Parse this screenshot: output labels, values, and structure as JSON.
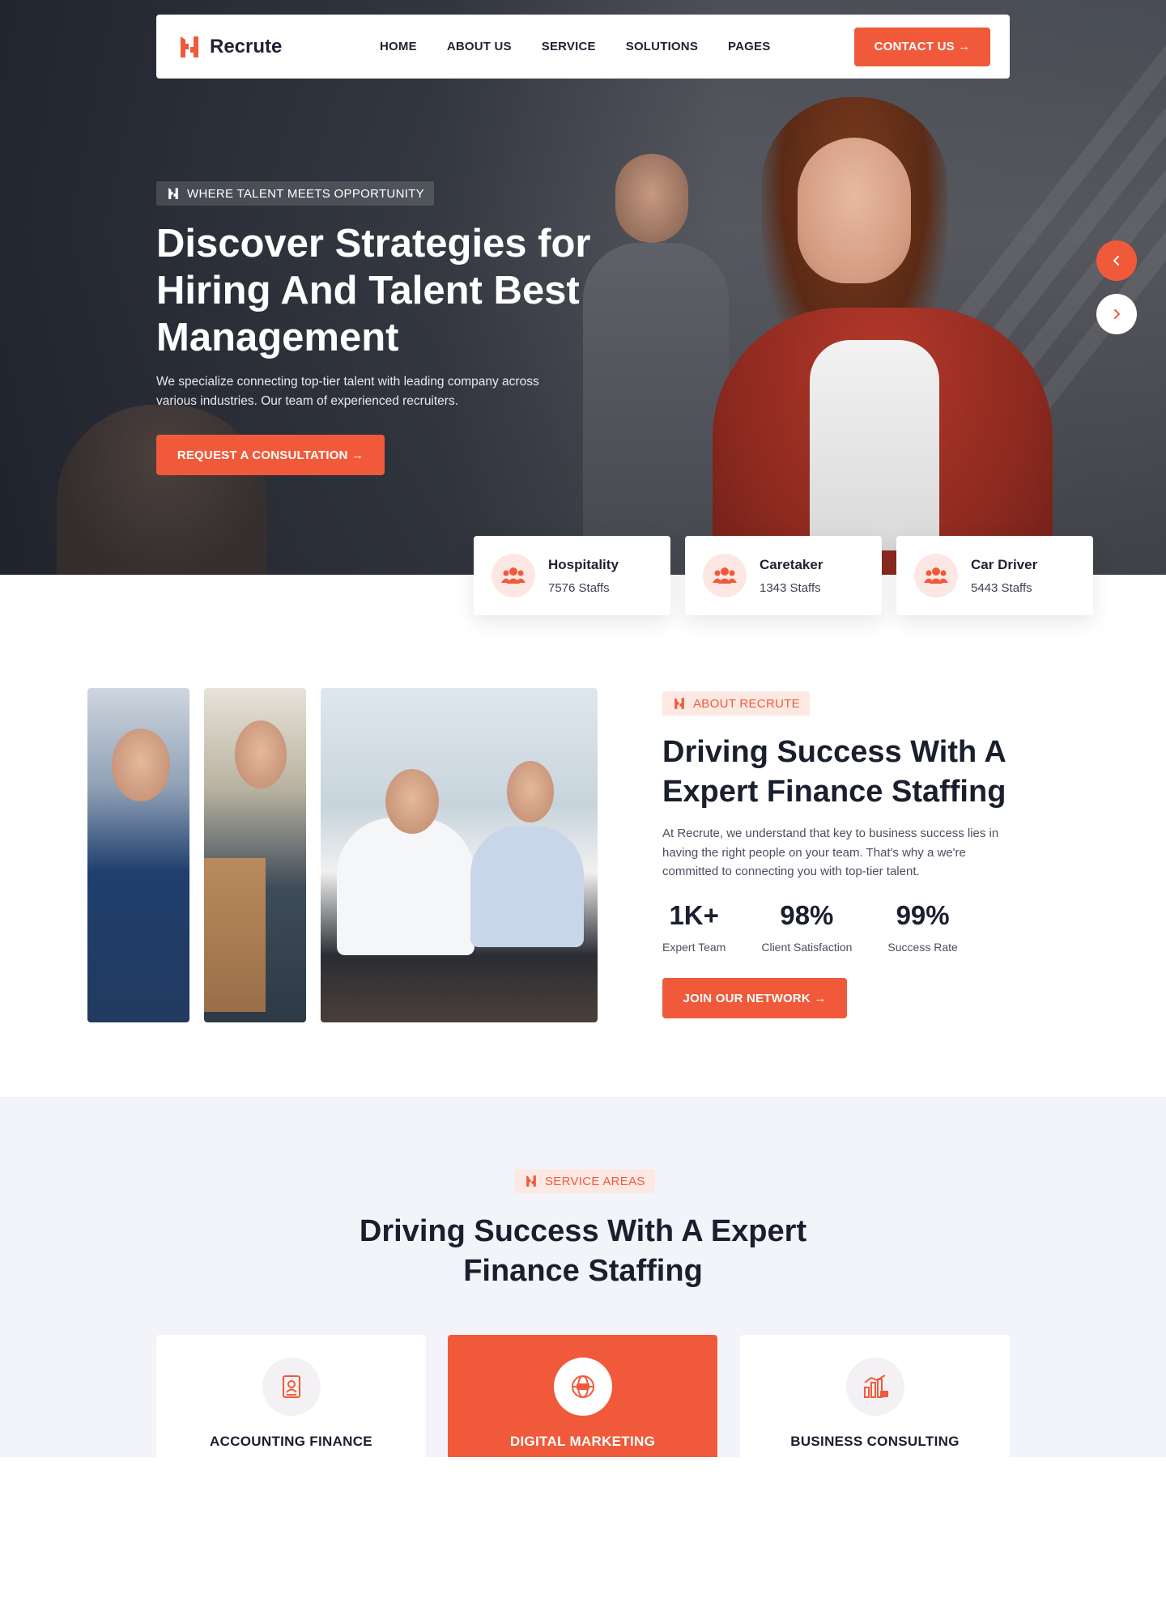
{
  "brand": {
    "name": "Recrute",
    "accent": "#f05a3a"
  },
  "nav": {
    "items": [
      "HOME",
      "ABOUT US",
      "SERVICE",
      "SOLUTIONS",
      "PAGES"
    ],
    "cta": "CONTACT US →"
  },
  "hero": {
    "eyebrow": "WHERE TALENT MEETS OPPORTUNITY",
    "title": "Discover Strategies for Hiring And Talent Best Management",
    "description": "We specialize connecting top-tier talent with leading company across various industries. Our team of experienced recruiters.",
    "cta": "REQUEST A CONSULTATION →",
    "prev_icon": "chevron-left-icon",
    "next_icon": "chevron-right-icon"
  },
  "categories": [
    {
      "name": "Hospitality",
      "count": "7576 Staffs",
      "icon": "users-icon"
    },
    {
      "name": "Caretaker",
      "count": "1343 Staffs",
      "icon": "users-icon"
    },
    {
      "name": "Car Driver",
      "count": "5443 Staffs",
      "icon": "users-icon"
    }
  ],
  "about": {
    "tag": "ABOUT RECRUTE",
    "title": "Driving Success With A Expert Finance Staffing",
    "description": "At Recrute, we understand that key to business success lies in having the right people on your team. That's why a we're committed to connecting you with top-tier talent.",
    "stats": [
      {
        "value": "1K+",
        "label": "Expert Team"
      },
      {
        "value": "98%",
        "label": "Client Satisfaction"
      },
      {
        "value": "99%",
        "label": "Success Rate"
      }
    ],
    "cta": "JOIN OUR NETWORK →"
  },
  "services": {
    "tag": "SERVICE AREAS",
    "title": "Driving Success With A Expert Finance Staffing",
    "items": [
      {
        "label": "ACCOUNTING FINANCE",
        "icon": "finance-document-icon",
        "active": false
      },
      {
        "label": "DIGITAL MARKETING",
        "icon": "seo-globe-icon",
        "active": true
      },
      {
        "label": "BUSINESS CONSULTING",
        "icon": "bar-chart-icon",
        "active": false
      }
    ]
  }
}
